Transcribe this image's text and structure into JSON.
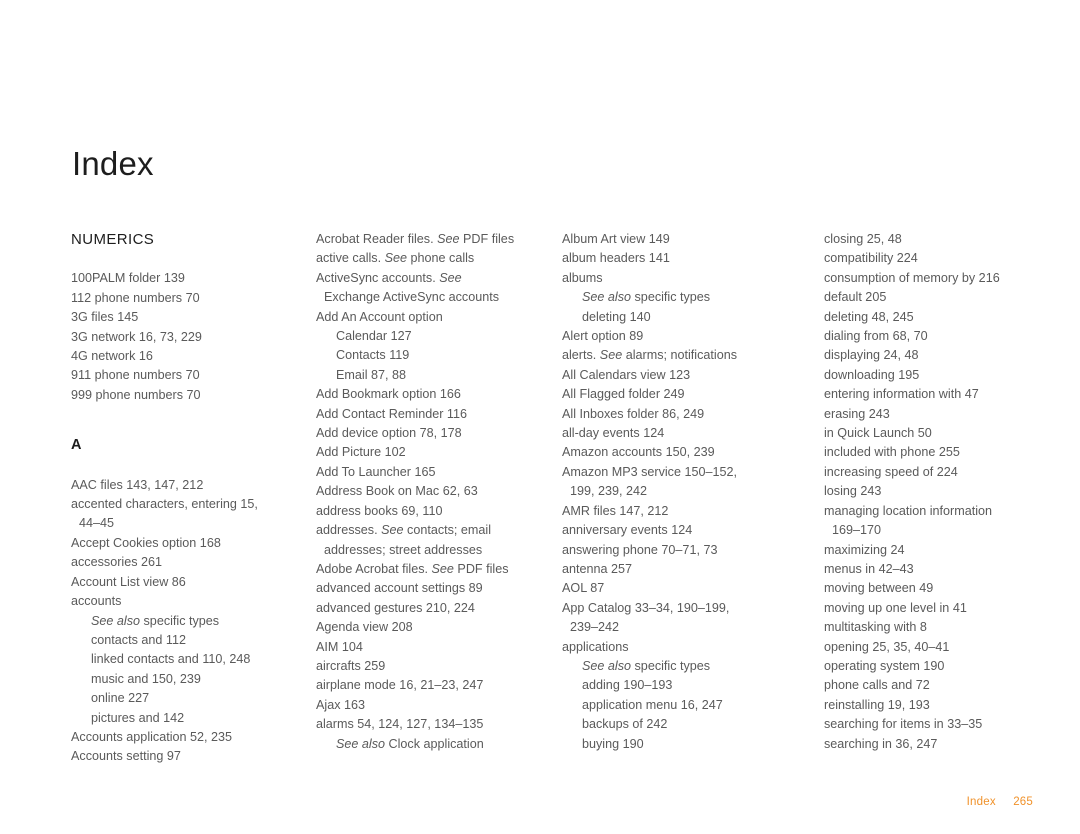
{
  "page": {
    "title": "Index",
    "footer": {
      "label": "Index",
      "page_number": "265",
      "color": "#f0922b"
    },
    "text_color": "#5a5a5a",
    "heading_color": "#1d1d1d"
  },
  "columns": [
    {
      "id": "column-1",
      "blocks": [
        {
          "type": "heading",
          "text": "NUMERICS"
        },
        {
          "type": "entry",
          "text": "100PALM folder 139"
        },
        {
          "type": "entry",
          "text": "112 phone numbers 70"
        },
        {
          "type": "entry",
          "text": "3G files 145"
        },
        {
          "type": "entry",
          "text": "3G network 16, 73, 229"
        },
        {
          "type": "entry",
          "text": "4G network 16"
        },
        {
          "type": "entry",
          "text": "911 phone numbers 70"
        },
        {
          "type": "entry",
          "text": "999 phone numbers 70"
        },
        {
          "type": "letter",
          "text": "A"
        },
        {
          "type": "entry",
          "text": "AAC files 143, 147, 212"
        },
        {
          "type": "entry",
          "text": "accented characters, entering 15,"
        },
        {
          "type": "cont",
          "text": "44–45"
        },
        {
          "type": "entry",
          "text": "Accept Cookies option 168"
        },
        {
          "type": "entry",
          "text": "accessories 261"
        },
        {
          "type": "entry",
          "text": "Account List view 86"
        },
        {
          "type": "entry",
          "text": "accounts"
        },
        {
          "type": "sub-ref",
          "italic": "See also",
          "text": " specific types"
        },
        {
          "type": "sub",
          "text": "contacts and 112"
        },
        {
          "type": "sub",
          "text": "linked contacts and 110, 248"
        },
        {
          "type": "sub",
          "text": "music and 150, 239"
        },
        {
          "type": "sub",
          "text": "online 227"
        },
        {
          "type": "sub",
          "text": "pictures and 142"
        },
        {
          "type": "entry",
          "text": "Accounts application 52, 235"
        },
        {
          "type": "entry",
          "text": "Accounts setting 97"
        }
      ]
    },
    {
      "id": "column-2",
      "blocks": [
        {
          "type": "entry",
          "text": "Acrobat Reader files. ",
          "italic_mid": "See",
          "text_after": " PDF files"
        },
        {
          "type": "entry",
          "text": "active calls. ",
          "italic_mid": "See",
          "text_after": " phone calls"
        },
        {
          "type": "entry",
          "text": "ActiveSync accounts. ",
          "italic_mid": "See",
          "text_after": ""
        },
        {
          "type": "cont",
          "text": "Exchange ActiveSync accounts"
        },
        {
          "type": "entry",
          "text": "Add An Account option"
        },
        {
          "type": "sub",
          "text": "Calendar 127"
        },
        {
          "type": "sub",
          "text": "Contacts 119"
        },
        {
          "type": "sub",
          "text": "Email 87, 88"
        },
        {
          "type": "entry",
          "text": "Add Bookmark option 166"
        },
        {
          "type": "entry",
          "text": "Add Contact Reminder 116"
        },
        {
          "type": "entry",
          "text": "Add device option 78, 178"
        },
        {
          "type": "entry",
          "text": "Add Picture 102"
        },
        {
          "type": "entry",
          "text": "Add To Launcher 165"
        },
        {
          "type": "entry",
          "text": "Address Book on Mac 62, 63"
        },
        {
          "type": "entry",
          "text": "address books 69, 110"
        },
        {
          "type": "entry",
          "text": "addresses. ",
          "italic_mid": "See",
          "text_after": " contacts; email"
        },
        {
          "type": "cont",
          "text": "addresses; street addresses"
        },
        {
          "type": "entry",
          "text": "Adobe Acrobat files. ",
          "italic_mid": "See",
          "text_after": " PDF files"
        },
        {
          "type": "entry",
          "text": "advanced account settings 89"
        },
        {
          "type": "entry",
          "text": "advanced gestures 210, 224"
        },
        {
          "type": "entry",
          "text": "Agenda view 208"
        },
        {
          "type": "entry",
          "text": "AIM 104"
        },
        {
          "type": "entry",
          "text": "aircrafts 259"
        },
        {
          "type": "entry",
          "text": "airplane mode 16, 21–23, 247"
        },
        {
          "type": "entry",
          "text": "Ajax 163"
        },
        {
          "type": "entry",
          "text": "alarms 54, 124, 127, 134–135"
        },
        {
          "type": "sub-ref",
          "italic": "See also",
          "text": " Clock application"
        }
      ]
    },
    {
      "id": "column-3",
      "blocks": [
        {
          "type": "entry",
          "text": "Album Art view 149"
        },
        {
          "type": "entry",
          "text": "album headers 141"
        },
        {
          "type": "entry",
          "text": "albums"
        },
        {
          "type": "sub-ref",
          "italic": "See also",
          "text": " specific types"
        },
        {
          "type": "sub",
          "text": "deleting 140"
        },
        {
          "type": "entry",
          "text": "Alert option 89"
        },
        {
          "type": "entry",
          "text": "alerts. ",
          "italic_mid": "See",
          "text_after": " alarms; notifications"
        },
        {
          "type": "entry",
          "text": "All Calendars view 123"
        },
        {
          "type": "entry",
          "text": "All Flagged folder 249"
        },
        {
          "type": "entry",
          "text": "All Inboxes folder 86, 249"
        },
        {
          "type": "entry",
          "text": "all-day events 124"
        },
        {
          "type": "entry",
          "text": "Amazon accounts 150, 239"
        },
        {
          "type": "entry",
          "text": "Amazon MP3 service 150–152,"
        },
        {
          "type": "cont",
          "text": "199, 239, 242"
        },
        {
          "type": "entry",
          "text": "AMR files 147, 212"
        },
        {
          "type": "entry",
          "text": "anniversary events 124"
        },
        {
          "type": "entry",
          "text": "answering phone 70–71, 73"
        },
        {
          "type": "entry",
          "text": "antenna 257"
        },
        {
          "type": "entry",
          "text": "AOL 87"
        },
        {
          "type": "entry",
          "text": "App Catalog 33–34, 190–199,"
        },
        {
          "type": "cont",
          "text": "239–242"
        },
        {
          "type": "entry",
          "text": "applications"
        },
        {
          "type": "sub-ref",
          "italic": "See also",
          "text": " specific types"
        },
        {
          "type": "sub",
          "text": "adding 190–193"
        },
        {
          "type": "sub",
          "text": "application menu 16, 247"
        },
        {
          "type": "sub",
          "text": "backups of 242"
        },
        {
          "type": "sub",
          "text": "buying 190"
        }
      ]
    },
    {
      "id": "column-4",
      "blocks": [
        {
          "type": "entry",
          "text": "closing 25, 48"
        },
        {
          "type": "entry",
          "text": "compatibility 224"
        },
        {
          "type": "entry",
          "text": "consumption of memory by 216"
        },
        {
          "type": "entry",
          "text": "default 205"
        },
        {
          "type": "entry",
          "text": "deleting 48, 245"
        },
        {
          "type": "entry",
          "text": "dialing from 68, 70"
        },
        {
          "type": "entry",
          "text": "displaying 24, 48"
        },
        {
          "type": "entry",
          "text": "downloading 195"
        },
        {
          "type": "entry",
          "text": "entering information with 47"
        },
        {
          "type": "entry",
          "text": "erasing 243"
        },
        {
          "type": "entry",
          "text": "in Quick Launch 50"
        },
        {
          "type": "entry",
          "text": "included with phone 255"
        },
        {
          "type": "entry",
          "text": "increasing speed of 224"
        },
        {
          "type": "entry",
          "text": "losing 243"
        },
        {
          "type": "entry",
          "text": "managing location information"
        },
        {
          "type": "cont",
          "text": "169–170"
        },
        {
          "type": "entry",
          "text": "maximizing 24"
        },
        {
          "type": "entry",
          "text": "menus in 42–43"
        },
        {
          "type": "entry",
          "text": "moving between 49"
        },
        {
          "type": "entry",
          "text": "moving up one level in 41"
        },
        {
          "type": "entry",
          "text": "multitasking with 8"
        },
        {
          "type": "entry",
          "text": "opening 25, 35, 40–41"
        },
        {
          "type": "entry",
          "text": "operating system 190"
        },
        {
          "type": "entry",
          "text": "phone calls and 72"
        },
        {
          "type": "entry",
          "text": "reinstalling 19, 193"
        },
        {
          "type": "entry",
          "text": "searching for items in 33–35"
        },
        {
          "type": "entry",
          "text": "searching in 36, 247"
        }
      ]
    }
  ]
}
